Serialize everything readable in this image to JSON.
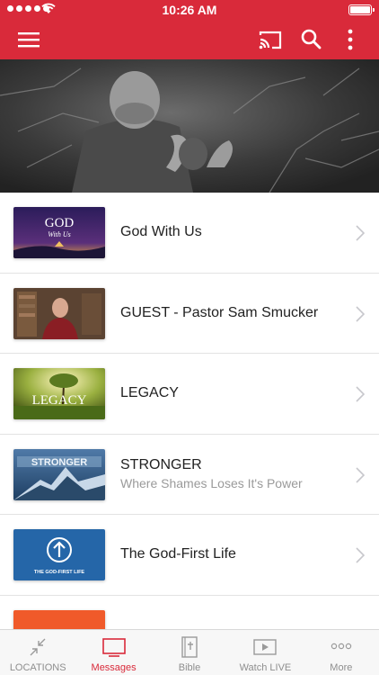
{
  "status_bar": {
    "time": "10:26 AM",
    "battery_level": 1.0
  },
  "nav": {
    "menu_icon": "hamburger-menu-icon",
    "cast_icon": "cast-icon",
    "search_icon": "search-icon",
    "more_icon": "vertical-dots-icon"
  },
  "colors": {
    "brand": "#d92a3a",
    "tab_inactive": "#8e8e8e",
    "subtitle": "#9a9a9a"
  },
  "messages": [
    {
      "title": "God With Us",
      "subtitle": "",
      "thumb_text": "GOD",
      "thumb_text_2": "With Us"
    },
    {
      "title": "GUEST - Pastor Sam Smucker",
      "subtitle": ""
    },
    {
      "title": "LEGACY",
      "subtitle": "",
      "thumb_text": "LEGACY"
    },
    {
      "title": "STRONGER",
      "subtitle": "Where Shames Loses It's Power",
      "thumb_text": "STRONGER"
    },
    {
      "title": "The God-First Life",
      "subtitle": "",
      "thumb_text": "THE GOD-FIRST LIFE"
    }
  ],
  "tabs": [
    {
      "label": "LOCATIONS",
      "icon": "locations-arrows-icon",
      "active": false
    },
    {
      "label": "Messages",
      "icon": "tv-screen-icon",
      "active": true
    },
    {
      "label": "Bible",
      "icon": "bible-book-icon",
      "active": false
    },
    {
      "label": "Watch LIVE",
      "icon": "video-play-icon",
      "active": false
    },
    {
      "label": "More",
      "icon": "ellipsis-icon",
      "active": false
    }
  ]
}
